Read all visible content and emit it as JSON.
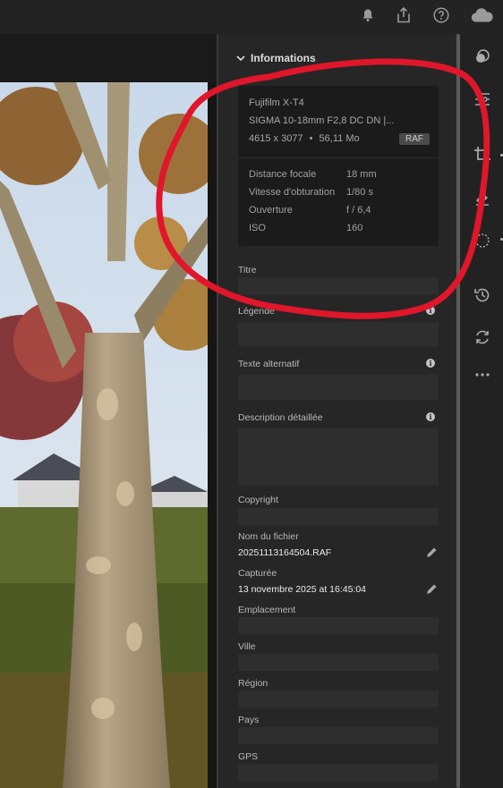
{
  "topbar": {
    "icons": [
      "bell-icon",
      "share-icon",
      "help-icon",
      "cloud-icon"
    ]
  },
  "panel": {
    "section_title": "Informations",
    "camera": {
      "model": "Fujifilm X-T4",
      "lens": "SIGMA 10-18mm F2,8 DC DN |...",
      "dimensions": "4615 x 3077",
      "separator": "•",
      "size": "56,11 Mo",
      "format_badge": "RAF"
    },
    "exif": [
      {
        "label": "Distance focale",
        "value": "18 mm"
      },
      {
        "label": "Vitesse d'obturation",
        "value": "1/80 s"
      },
      {
        "label": "Ouverture",
        "value": "f / 6,4"
      },
      {
        "label": "ISO",
        "value": "160"
      }
    ],
    "fields": {
      "title_label": "Titre",
      "caption_label": "Légende",
      "alt_label": "Texte alternatif",
      "description_label": "Description détaillée",
      "copyright_label": "Copyright",
      "filename_label": "Nom du fichier",
      "filename_value": "20251113164504.RAF",
      "captured_label": "Capturée",
      "captured_value": "13 novembre 2025 at 16:45:04",
      "location_label": "Emplacement",
      "city_label": "Ville",
      "region_label": "Région",
      "country_label": "Pays",
      "gps_label": "GPS"
    }
  },
  "toolstrip": {
    "icons": [
      "edit-icon",
      "adjustments-icon",
      "crop-icon",
      "eraser-icon",
      "mask-icon",
      "history-icon",
      "versions-icon",
      "more-icon"
    ]
  },
  "colors": {
    "panel_bg": "#262626",
    "card_bg": "#1b1b1b",
    "annotation_red": "#e0162b"
  }
}
